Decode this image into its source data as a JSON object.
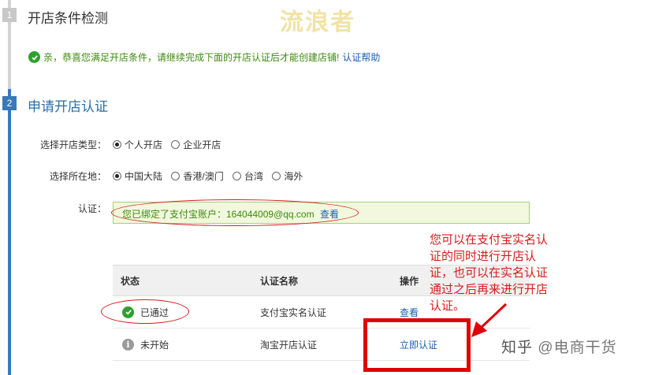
{
  "watermark": "流浪者",
  "steps": [
    {
      "number": "1",
      "title": "开店条件检测"
    },
    {
      "number": "2",
      "title": "申请开店认证"
    }
  ],
  "notice": {
    "text": "亲，恭喜您满足开店条件，请继续完成下面的开店认证后才能创建店铺!",
    "link": "认证帮助"
  },
  "form": {
    "shop_type": {
      "label": "选择开店类型：",
      "options": [
        {
          "label": "个人开店",
          "selected": true
        },
        {
          "label": "企业开店",
          "selected": false
        }
      ]
    },
    "location": {
      "label": "选择所在地：",
      "options": [
        {
          "label": "中国大陆",
          "selected": true
        },
        {
          "label": "香港/澳门",
          "selected": false
        },
        {
          "label": "台湾",
          "selected": false
        },
        {
          "label": "海外",
          "selected": false
        }
      ]
    },
    "auth": {
      "label": "认证：",
      "text": "您已绑定了支付宝账户：164044009@qq.com",
      "link": "查看"
    }
  },
  "table": {
    "headers": {
      "status": "状态",
      "name": "认证名称",
      "action": "操作"
    },
    "rows": [
      {
        "status": "已通过",
        "status_icon": "check-circle-icon",
        "name": "支付宝实名认证",
        "action": "查看"
      },
      {
        "status": "未开始",
        "status_icon": "info-circle-icon",
        "name": "淘宝开店认证",
        "action": "立即认证"
      }
    ]
  },
  "annotation": "您可以在支付宝实名认证的同时进行开店认证，也可以在实名认证通过之后再来进行开店认证。",
  "footer_watermark": {
    "site": "知乎",
    "account": "@电商干货"
  },
  "colors": {
    "accent": "#3a78b8",
    "success": "#2e9f2e",
    "highlight": "#e00000"
  }
}
